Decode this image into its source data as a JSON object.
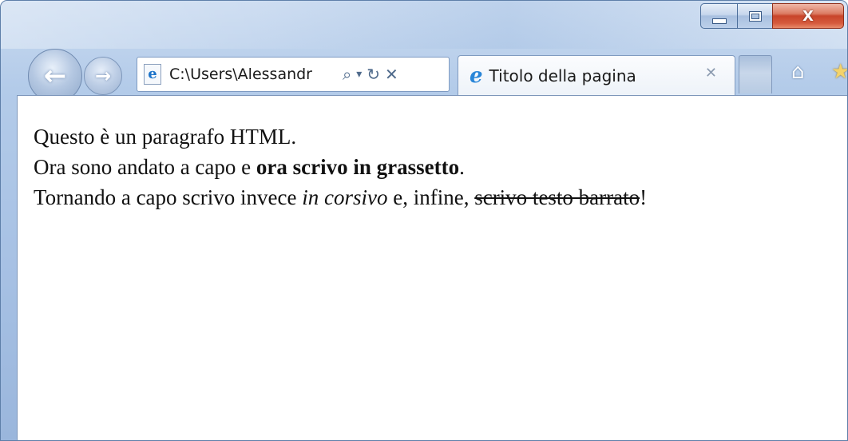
{
  "window": {
    "caption_buttons": {
      "minimize": "minimize-icon",
      "maximize": "maximize-icon",
      "close": "X"
    }
  },
  "toolbar": {
    "back_icon": "back-arrow-icon",
    "forward_icon": "forward-arrow-icon",
    "address": "C:\\Users\\Alessandr",
    "address_tools": {
      "search_icon": "search-icon",
      "dropdown_icon": "chevron-down-icon",
      "refresh_icon": "refresh-icon",
      "stop_icon": "close-icon"
    },
    "home_icon": "home-icon",
    "favorites_icon": "star-icon"
  },
  "tabs": [
    {
      "title": "Titolo della pagina",
      "active": true,
      "icon": "ie-page-icon"
    }
  ],
  "page": {
    "line1": "Questo è un paragrafo HTML.",
    "line2_prefix": "Ora sono andato a capo e ",
    "line2_bold": "ora scrivo in grassetto",
    "line2_suffix": ".",
    "line3_prefix": "Tornando a capo scrivo invece ",
    "line3_italic": "in corsivo",
    "line3_middle": " e, infine, ",
    "line3_strike": "scrivo testo barrato",
    "line3_suffix": "!"
  },
  "colors": {
    "frame": "#a7c1e4",
    "close_button": "#c8452a",
    "ie_blue": "#1b73c9"
  }
}
